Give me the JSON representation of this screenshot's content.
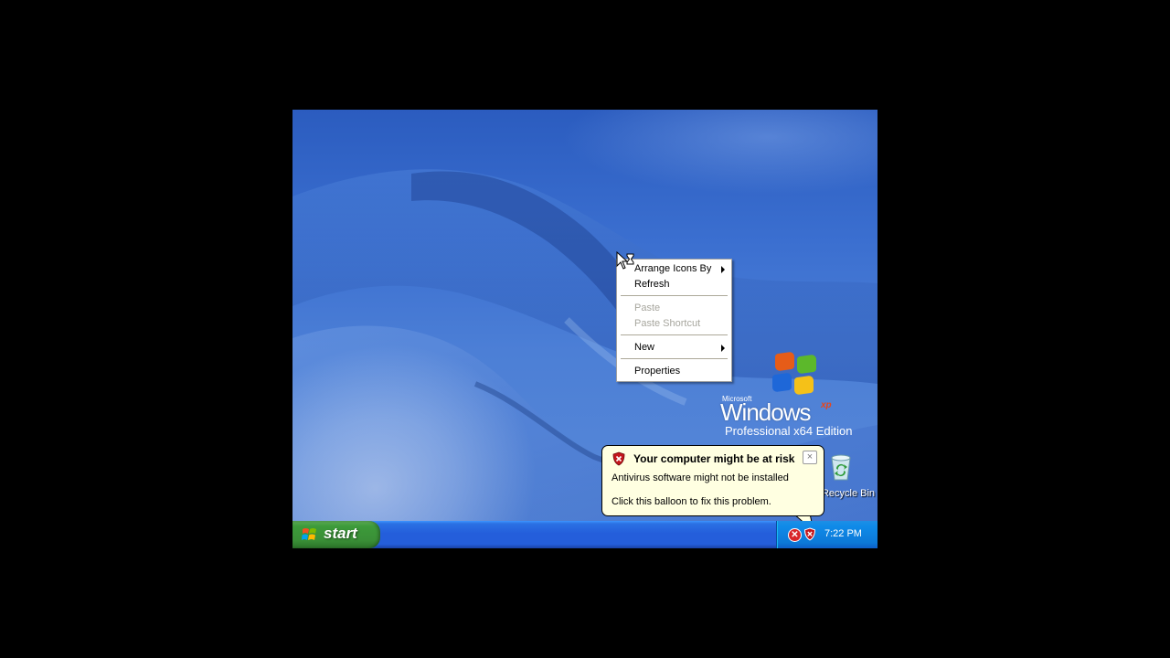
{
  "desktop": {
    "logo": {
      "microsoft": "Microsoft",
      "windows": "Windows",
      "xp": "xp",
      "edition": "Professional x64 Edition"
    },
    "icons": [
      {
        "label": "Recycle Bin",
        "icon": "recycle-bin-icon"
      }
    ]
  },
  "context_menu": {
    "items": [
      {
        "label": "Arrange Icons By",
        "enabled": true,
        "submenu": true
      },
      {
        "label": "Refresh",
        "enabled": true,
        "submenu": false
      },
      {
        "label": "Paste",
        "enabled": false,
        "submenu": false
      },
      {
        "label": "Paste Shortcut",
        "enabled": false,
        "submenu": false
      },
      {
        "label": "New",
        "enabled": true,
        "submenu": true
      },
      {
        "label": "Properties",
        "enabled": true,
        "submenu": false
      }
    ]
  },
  "balloon": {
    "title": "Your computer might be at risk",
    "line1": "Antivirus software might not be installed",
    "line2": "Click this balloon to fix this problem.",
    "close": "×",
    "icon": "security-shield-icon"
  },
  "taskbar": {
    "start_label": "start",
    "clock": "7:22 PM",
    "tray_icons": [
      "error-icon",
      "security-shield-icon"
    ]
  },
  "colors": {
    "taskbar_blue": "#245edb",
    "start_green": "#3c9a3a",
    "tray_blue": "#0c79d8",
    "balloon_bg": "#ffffe1",
    "disabled_text": "#a7a69e"
  }
}
